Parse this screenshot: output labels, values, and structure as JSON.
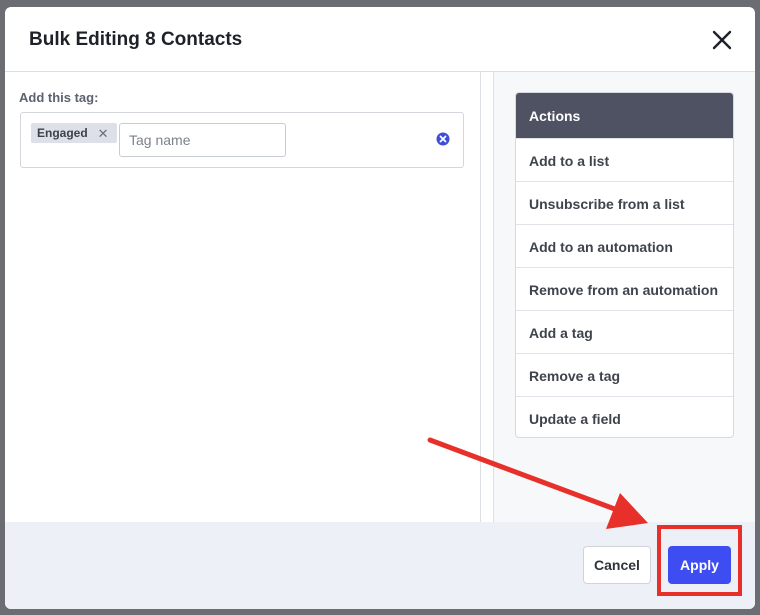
{
  "modal": {
    "title": "Bulk Editing 8 Contacts"
  },
  "tag_editor": {
    "label": "Add this tag:",
    "tags": [
      {
        "label": "Engaged"
      }
    ],
    "input_value": "",
    "input_placeholder": "Tag name"
  },
  "actions": {
    "header": "Actions",
    "items": [
      {
        "label": "Add to a list"
      },
      {
        "label": "Unsubscribe from a list"
      },
      {
        "label": "Add to an automation"
      },
      {
        "label": "Remove from an automation"
      },
      {
        "label": "Add a tag"
      },
      {
        "label": "Remove a tag"
      },
      {
        "label": "Update a field"
      }
    ]
  },
  "footer": {
    "cancel_label": "Cancel",
    "apply_label": "Apply"
  },
  "icons": {
    "close": "close-icon",
    "tag_remove": "remove-tag-icon",
    "clear": "clear-circle-icon"
  },
  "colors": {
    "actions_header_bg": "#4f5263",
    "apply_bg": "#3d4df2",
    "annotation": "#e8302a",
    "footer_bg": "#eef0f8"
  }
}
